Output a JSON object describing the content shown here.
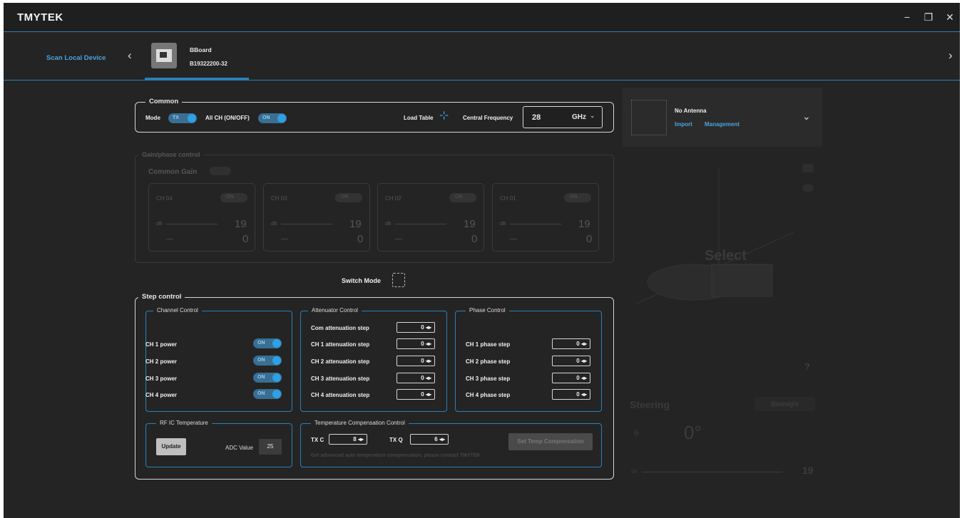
{
  "app": {
    "logo": "TMYTEK"
  },
  "window": {
    "minimize": "−",
    "maximize": "❐",
    "close": "✕"
  },
  "device_bar": {
    "scan": "Scan Local Device",
    "prev": "‹",
    "next": "›",
    "device_name": "BBoard",
    "device_serial": "B19322200-32"
  },
  "common": {
    "legend": "Common",
    "mode_label": "Mode",
    "mode_value": "TX",
    "allch_label": "All CH (ON/OFF)",
    "allch_value": "ON",
    "load_table": "Load Table",
    "central_freq_label": "Central Frequency",
    "freq_value": "28",
    "freq_unit": "GHz"
  },
  "gain": {
    "legend": "Gain/phase control",
    "common_gain": "Common Gain",
    "channels": [
      {
        "name": "CH 04",
        "on": "ON",
        "db": "dB",
        "db_value": "19",
        "phase_value": "0"
      },
      {
        "name": "CH 03",
        "on": "ON",
        "db": "dB",
        "db_value": "19",
        "phase_value": "0"
      },
      {
        "name": "CH 02",
        "on": "ON",
        "db": "dB",
        "db_value": "19",
        "phase_value": "0"
      },
      {
        "name": "CH 01",
        "on": "ON",
        "db": "dB",
        "db_value": "19",
        "phase_value": "0"
      }
    ]
  },
  "switch_mode": "Switch Mode",
  "step": {
    "legend": "Step control",
    "channel_control": {
      "title": "Channel Control",
      "items": [
        {
          "label": "CH 1 power",
          "value": "ON"
        },
        {
          "label": "CH 2 power",
          "value": "ON"
        },
        {
          "label": "CH 3 power",
          "value": "ON"
        },
        {
          "label": "CH 4 power",
          "value": "ON"
        }
      ]
    },
    "attenuator": {
      "title": "Attenuator Control",
      "items": [
        {
          "label": "Com attenuation step",
          "value": "0"
        },
        {
          "label": "CH 1 attenuation step",
          "value": "0"
        },
        {
          "label": "CH 2 attenuation step",
          "value": "0"
        },
        {
          "label": "CH 3 attenuation step",
          "value": "0"
        },
        {
          "label": "CH 4 attenuation step",
          "value": "0"
        }
      ]
    },
    "phase": {
      "title": "Phase Control",
      "items": [
        {
          "label": "CH 1 phase step",
          "value": "0"
        },
        {
          "label": "CH 2 phase step",
          "value": "0"
        },
        {
          "label": "CH 3 phase step",
          "value": "0"
        },
        {
          "label": "CH 4 phase step",
          "value": "0"
        }
      ]
    },
    "rfic": {
      "title": "RF IC Temperature",
      "update": "Update",
      "adc_label": "ADC Value",
      "adc_value": "25"
    },
    "tempcomp": {
      "title": "Temperature Compensation Control",
      "txc_label": "TX C",
      "txc_value": "8",
      "txq_label": "TX Q",
      "txq_value": "6",
      "set_btn": "Set Temp Compensation",
      "note": "Get advanced auto temperature compensation, please contact TMYTEK"
    }
  },
  "antenna": {
    "title": "No Antenna",
    "import": "Import",
    "management": "Management"
  },
  "viz": {
    "select": "Select",
    "question": "?",
    "steering": "Steering",
    "boresight": "Boresight",
    "theta": "θ",
    "angle": "0°",
    "db": "dB",
    "db_value": "19"
  }
}
